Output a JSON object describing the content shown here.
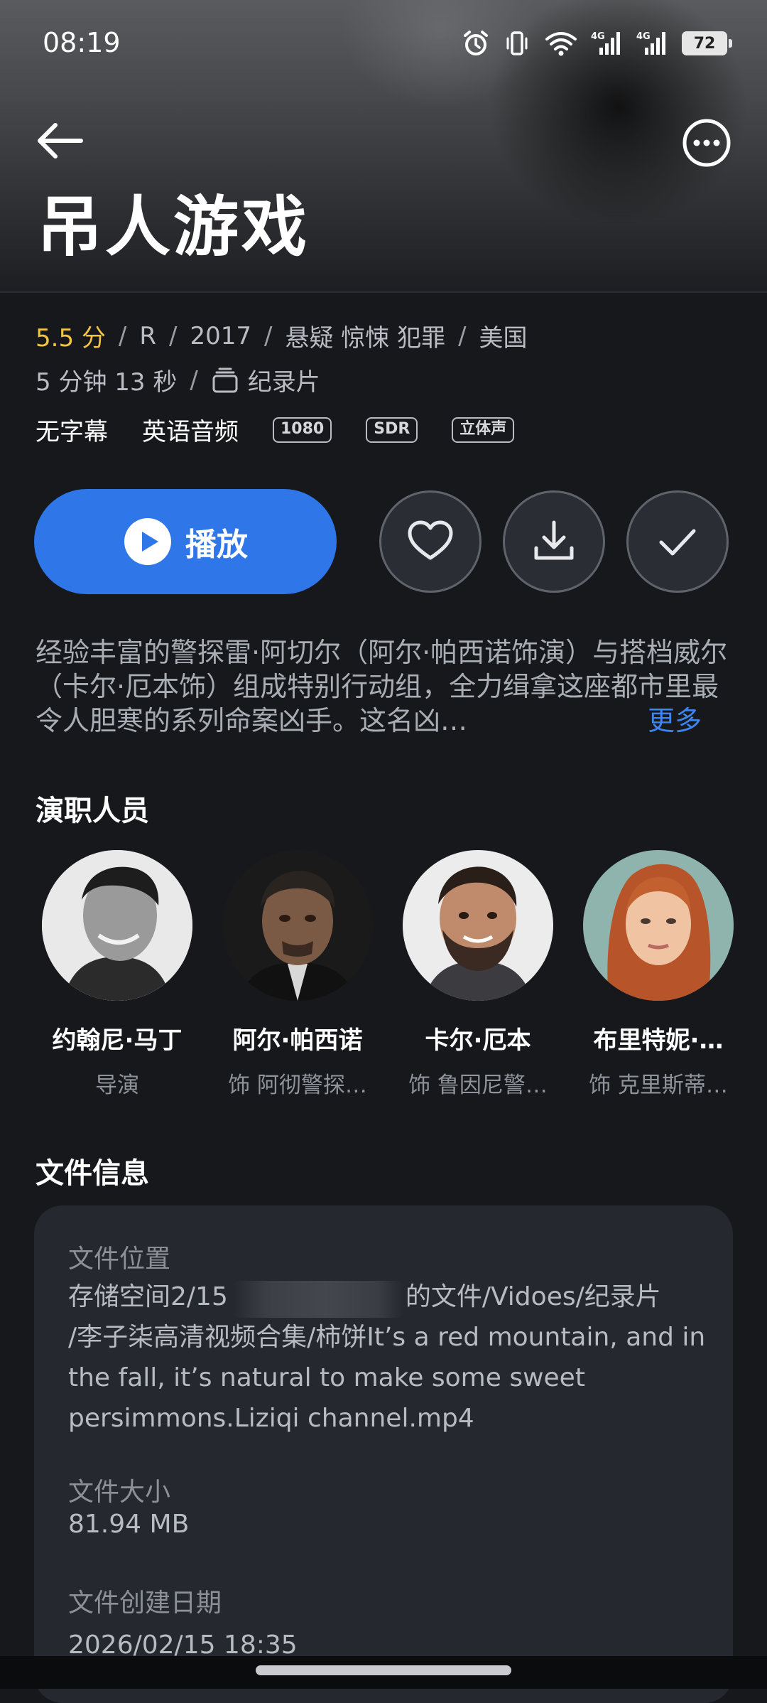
{
  "status_bar": {
    "time": "08:19",
    "battery": "72",
    "icons": [
      "alarm-icon",
      "vibrate-icon",
      "wifi-icon",
      "signal-4g-icon",
      "signal-4g-icon",
      "battery-icon"
    ]
  },
  "header": {
    "title": "吊人游戏"
  },
  "meta": {
    "rating": "5.5 分",
    "rated": "R",
    "year": "2017",
    "genres": "悬疑 惊悚 犯罪",
    "country": "美国",
    "duration": "5 分钟 13 秒",
    "category": "纪录片"
  },
  "tags": {
    "subtitle": "无字幕",
    "audio": "英语音频",
    "badges": [
      "1080",
      "SDR",
      "立体声"
    ]
  },
  "actions": {
    "play_label": "播放"
  },
  "description": {
    "text": "经验丰富的警探雷·阿切尔（阿尔·帕西诺饰演）与搭档威尔（卡尔·厄本饰）组成特别行动组，全力缉拿这座都市里最令人胆寒的系列命案凶手。这名凶…",
    "more_label": "更多"
  },
  "cast": {
    "title": "演职人员",
    "members": [
      {
        "name": "约翰尼·马丁",
        "role": "导演"
      },
      {
        "name": "阿尔·帕西诺",
        "role": "饰 阿彻警探…"
      },
      {
        "name": "卡尔·厄本",
        "role": "饰 鲁因尼警…"
      },
      {
        "name": "布里特妮·…",
        "role": "饰 克里斯蒂…"
      }
    ]
  },
  "file_info": {
    "title": "文件信息",
    "location_label": "文件位置",
    "location_line1": "存储空间2/15",
    "location_line1_end": "的文件/Vidoes/纪录片",
    "location_rest": "/李子柒高清视频合集/柿饼It’s a red mountain, and in the fall, it’s natural to make some sweet persimmons.Liziqi channel.mp4",
    "size_label": "文件大小",
    "size_value": "81.94 MB",
    "date_label": "文件创建日期",
    "date_value": "2026/02/15 18:35"
  },
  "colors": {
    "accent": "#2f76e8",
    "rating": "#f5c542",
    "link": "#3d86f0",
    "background": "#16181c",
    "card": "#25282e"
  }
}
